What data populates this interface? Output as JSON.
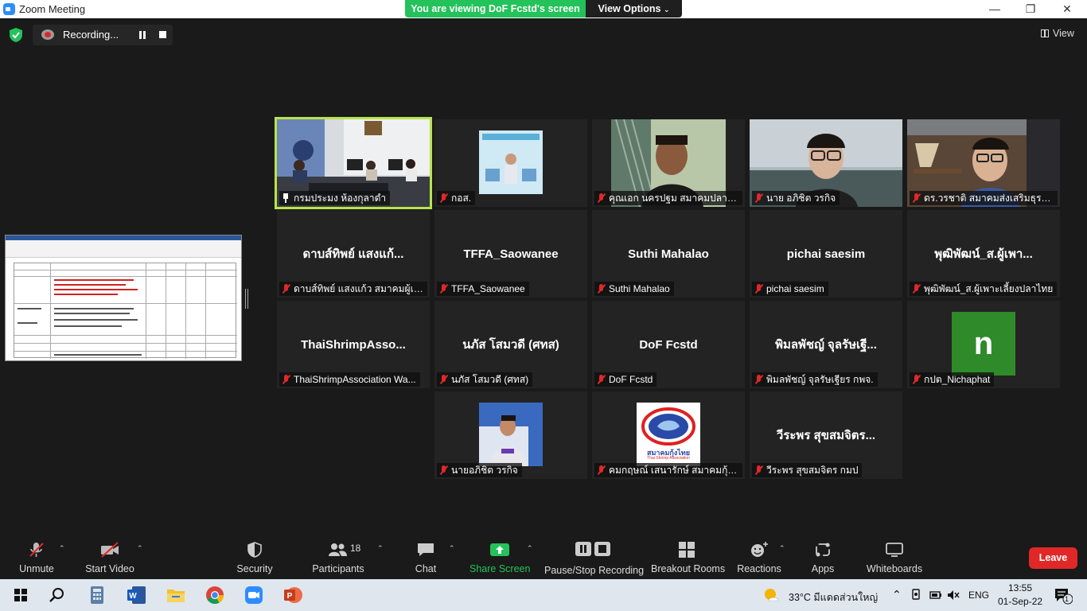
{
  "window": {
    "title": "Zoom Meeting",
    "minimize": "—",
    "restore": "❐",
    "close": "✕"
  },
  "banner": {
    "viewing": "You are viewing DoF Fcstd's screen",
    "view_options": "View Options"
  },
  "recording": {
    "label": "Recording..."
  },
  "view_button": "View",
  "participants": [
    {
      "name": "กรมประมง ห้องกุลาดำ",
      "big": "",
      "video": "room",
      "mic": "pin",
      "active": true
    },
    {
      "name": "กอส.",
      "big": "",
      "video": "poster",
      "mic": "off"
    },
    {
      "name": "คุณเอก นครปฐม สมาคมปลากัด",
      "big": "",
      "video": "man-green",
      "mic": "off"
    },
    {
      "name": "นาย อภิชิต วรกิจ",
      "big": "",
      "video": "man-glasses",
      "mic": "off"
    },
    {
      "name": "ดร.วรชาติ สมาคมส่งเสริมธุรกิจเ...",
      "big": "",
      "video": "man-office",
      "mic": "off"
    },
    {
      "name": "ดาบส์ทิพย์ แสงแก้ว สมาคมผู้เพา...",
      "big": "ดาบส์ทิพย์ แสงแก้...",
      "video": "",
      "mic": "off"
    },
    {
      "name": "TFFA_Saowanee",
      "big": "TFFA_Saowanee",
      "video": "",
      "mic": "off"
    },
    {
      "name": "Suthi Mahalao",
      "big": "Suthi Mahalao",
      "video": "",
      "mic": "off"
    },
    {
      "name": "pichai saesim",
      "big": "pichai saesim",
      "video": "",
      "mic": "off"
    },
    {
      "name": "พุฒิพัฒน์_ส.ผู้เพาะเลี้ยงปลาไทย",
      "big": "พุฒิพัฒน์_ส.ผู้เพา...",
      "video": "",
      "mic": "off"
    },
    {
      "name": "ThaiShrimpAssociation Wa...",
      "big": "ThaiShrimpAsso...",
      "video": "",
      "mic": "off"
    },
    {
      "name": "นภัส โสมวดี (ศทส)",
      "big": "นภัส โสมวดี (ศทส)",
      "video": "",
      "mic": "off"
    },
    {
      "name": "DoF Fcstd",
      "big": "DoF Fcstd",
      "video": "",
      "mic": "off"
    },
    {
      "name": "พิมลพัชญ์ จุลรัษเฐียร กพจ.",
      "big": "พิมลพัชญ์ จุลรัษเฐี...",
      "video": "",
      "mic": "off"
    },
    {
      "name": "กปต_Nichaphat",
      "big": "",
      "video": "avatar",
      "mic": "off",
      "avatar": "n"
    },
    {
      "name": "นายอภิชิต วรกิจ",
      "big": "",
      "video": "portrait",
      "mic": "off"
    },
    {
      "name": "คมกฤษณ์ เสนารักษ์ สมาคมกุ้งไทย",
      "big": "",
      "video": "logo",
      "mic": "off",
      "logo_text": "สมาคมกุ้งไทย",
      "logo_sub": "Thai Shrimp Association"
    },
    {
      "name": "วีระพร สุขสมจิตร กมป",
      "big": "วีระพร สุขสมจิตร...",
      "video": "",
      "mic": "off"
    }
  ],
  "controls": {
    "unmute": "Unmute",
    "start_video": "Start Video",
    "security": "Security",
    "participants": "Participants",
    "participants_count": "18",
    "chat": "Chat",
    "share_screen": "Share Screen",
    "pause_recording": "Pause/Stop Recording",
    "breakout": "Breakout Rooms",
    "reactions": "Reactions",
    "apps": "Apps",
    "whiteboards": "Whiteboards",
    "leave": "Leave"
  },
  "taskbar": {
    "weather": "33°C มีแดดส่วนใหญ่",
    "lang": "ENG",
    "time": "13:55",
    "date": "01-Sep-22",
    "notifications": "1"
  },
  "colors": {
    "active_speaker": "#b9e34b",
    "banner_green": "#23c25a",
    "leave_red": "#e02828",
    "share_green": "#23c25a",
    "zoom_blue": "#2d8cff"
  }
}
